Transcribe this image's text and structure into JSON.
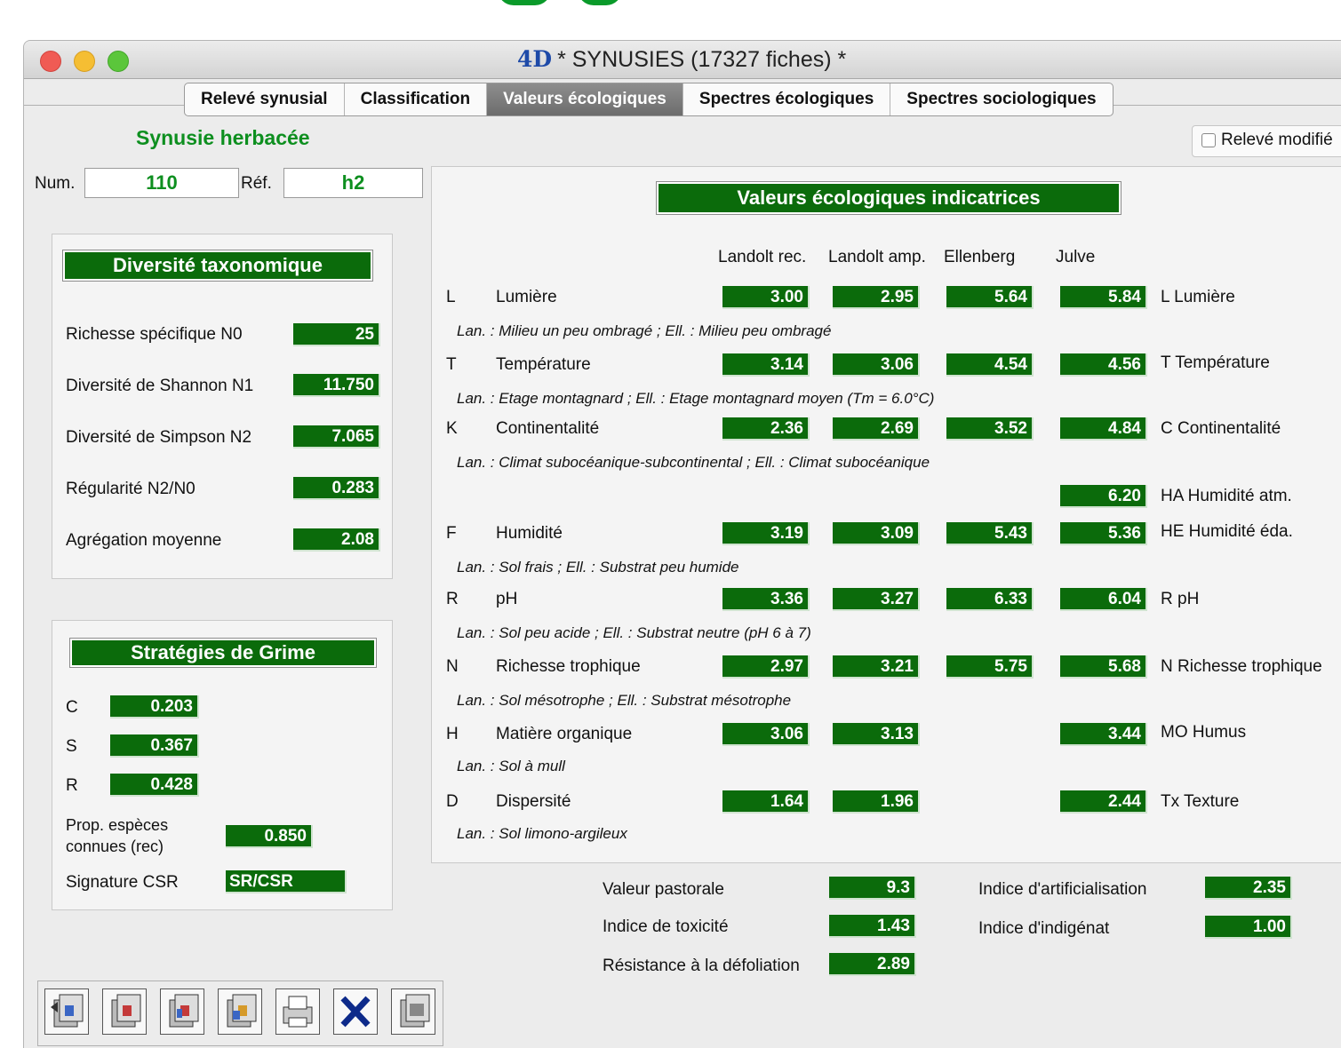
{
  "window": {
    "title": "* SYNUSIES (17327 fiches) *",
    "logo": "4D"
  },
  "tabs": [
    "Relevé synusial",
    "Classification",
    "Valeurs écologiques",
    "Spectres écologiques",
    "Spectres sociologiques"
  ],
  "active_tab": "Valeurs écologiques",
  "synusie_title": "Synusie herbacée",
  "releve_modifie": "Relevé modifié",
  "num": {
    "label": "Num.",
    "value": "110"
  },
  "ref": {
    "label": "Réf.",
    "value": "h2"
  },
  "diversite": {
    "title": "Diversité taxonomique",
    "rows": [
      {
        "label": "Richesse spécifique N0",
        "value": "25"
      },
      {
        "label": "Diversité de Shannon N1",
        "value": "11.750"
      },
      {
        "label": "Diversité de Simpson N2",
        "value": "7.065"
      },
      {
        "label": "Régularité N2/N0",
        "value": "0.283"
      },
      {
        "label": "Agrégation moyenne",
        "value": "2.08"
      }
    ]
  },
  "grime": {
    "title": "Stratégies de Grime",
    "c": {
      "label": "C",
      "value": "0.203"
    },
    "s": {
      "label": "S",
      "value": "0.367"
    },
    "r": {
      "label": "R",
      "value": "0.428"
    },
    "prop_line1": "Prop. espèces",
    "prop_line2": "connues (rec)",
    "prop_value": "0.850",
    "signature_label": "Signature CSR",
    "signature_value": "SR/CSR"
  },
  "ecol": {
    "title": "Valeurs écologiques indicatrices",
    "columns": [
      "Landolt rec.",
      "Landolt amp.",
      "Ellenberg",
      "Julve"
    ],
    "rows": [
      {
        "code": "L",
        "name": "Lumière",
        "lr": "3.00",
        "la": "2.95",
        "ell": "5.64",
        "julve": "5.84",
        "julve_label": "L Lumière",
        "note": "Lan. : Milieu un peu ombragé ; Ell. : Milieu peu ombragé"
      },
      {
        "code": "T",
        "name": "Température",
        "lr": "3.14",
        "la": "3.06",
        "ell": "4.54",
        "julve": "4.56",
        "julve_label": "T Température",
        "note": "Lan. : Etage montagnard ; Ell. : Etage montagnard moyen (Tm = 6.0°C)"
      },
      {
        "code": "K",
        "name": "Continentalité",
        "lr": "2.36",
        "la": "2.69",
        "ell": "3.52",
        "julve": "4.84",
        "julve_label": "C Continentalité",
        "note": "Lan. : Climat subocéanique-subcontinental ; Ell. : Climat subocéanique"
      },
      {
        "julve": "6.20",
        "julve_label": "HA Humidité atm."
      },
      {
        "code": "F",
        "name": "Humidité",
        "lr": "3.19",
        "la": "3.09",
        "ell": "5.43",
        "julve": "5.36",
        "julve_label": "HE Humidité éda.",
        "note": "Lan. : Sol frais ; Ell. : Substrat peu humide"
      },
      {
        "code": "R",
        "name": "pH",
        "lr": "3.36",
        "la": "3.27",
        "ell": "6.33",
        "julve": "6.04",
        "julve_label": "R pH",
        "note": "Lan. : Sol peu acide ; Ell. : Substrat neutre (pH 6 à 7)"
      },
      {
        "code": "N",
        "name": "Richesse trophique",
        "lr": "2.97",
        "la": "3.21",
        "ell": "5.75",
        "julve": "5.68",
        "julve_label": "N Richesse trophique",
        "note": "Lan. : Sol mésotrophe ; Ell. : Substrat mésotrophe"
      },
      {
        "code": "H",
        "name": "Matière organique",
        "lr": "3.06",
        "la": "3.13",
        "julve": "3.44",
        "julve_label": "MO Humus",
        "note": "Lan. : Sol à mull"
      },
      {
        "code": "D",
        "name": "Dispersité",
        "lr": "1.64",
        "la": "1.96",
        "julve": "2.44",
        "julve_label": "Tx Texture",
        "note": "Lan. : Sol limono-argileux"
      }
    ]
  },
  "indices": {
    "valeur_pastorale": {
      "label": "Valeur pastorale",
      "value": "9.3"
    },
    "toxicite": {
      "label": "Indice de toxicité",
      "value": "1.43"
    },
    "defoliation": {
      "label": "Résistance à la défoliation",
      "value": "2.89"
    },
    "artificialisation": {
      "label": "Indice d'artificialisation",
      "value": "2.35"
    },
    "indigenat": {
      "label": "Indice d'indigénat",
      "value": "1.00"
    }
  },
  "toolbar_icons": [
    "first-record-icon",
    "previous-record-icon",
    "next-record-icon",
    "last-record-icon",
    "print-icon",
    "delete-icon",
    "save-icon"
  ],
  "colors": {
    "value_green": "#0b6b0b",
    "title_green": "#0d8f1f"
  }
}
